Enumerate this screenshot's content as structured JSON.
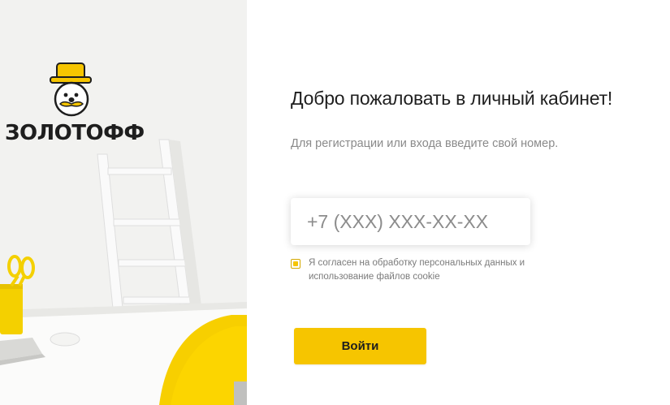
{
  "brand": {
    "name": "ЗОЛОТОФФ",
    "logo_icon": "mascot-top-hat-mustache-icon",
    "accent_color": "#f6c500"
  },
  "login_form": {
    "title": "Добро пожаловать в личный кабинет!",
    "subtitle": "Для регистрации или входа введите свой номер.",
    "phone_placeholder": "+7 (XXX) XXX-XX-XX",
    "phone_value": "",
    "consent_checked": true,
    "consent_text": "Я согласен на обработку персональных данных и использование файлов cookie",
    "submit_label": "Войти"
  },
  "colors": {
    "accent": "#f6c500",
    "text_primary": "#1f1f1f",
    "text_secondary": "#8a8a8a"
  }
}
